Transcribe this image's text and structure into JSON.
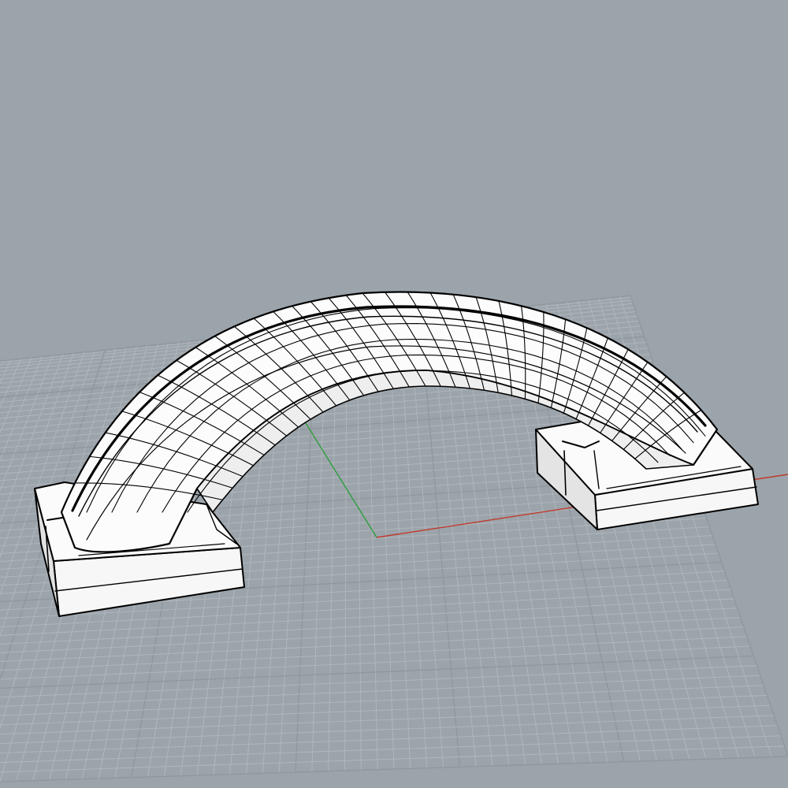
{
  "viewport": {
    "background_color": "#9ca4ab",
    "grid_color": "#b2b7bc",
    "grid_major_color": "#8f969c",
    "x_axis_color": "#c0392b",
    "y_axis_color": "#2e9e3e",
    "model_fill_color": "#ffffff",
    "model_edge_color": "#000000"
  },
  "model": {
    "object": "arched-handle",
    "display_mode": "wireframe-shaded"
  }
}
